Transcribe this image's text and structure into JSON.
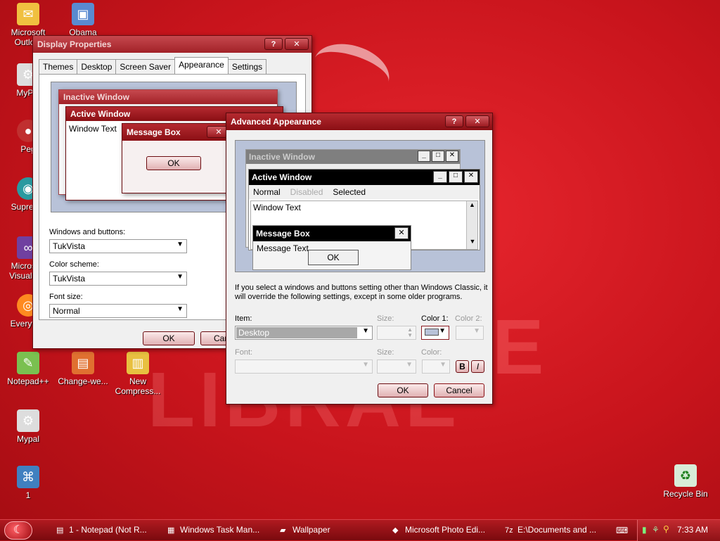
{
  "desktop": {
    "icons": [
      {
        "label": "Microsoft Outlo...",
        "glyph": "✉",
        "color": "#f0c040"
      },
      {
        "label": "Obama",
        "glyph": "▣",
        "color": "#5a8ad0"
      },
      {
        "label": "MyPal",
        "glyph": "⚙",
        "color": "#555555"
      },
      {
        "label": "Peg",
        "glyph": "●",
        "color": "#c03030"
      },
      {
        "label": "Supremo",
        "glyph": "◉",
        "color": "#2a9aa0"
      },
      {
        "label": "Microsoft Visual S...",
        "glyph": "∞",
        "color": "#7040a0"
      },
      {
        "label": "Everyth...",
        "glyph": "◎",
        "color": "#ff8a20"
      },
      {
        "label": "Notepad++",
        "glyph": "✎",
        "color": "#7ac050"
      },
      {
        "label": "Change-we...",
        "glyph": "▤",
        "color": "#e07030"
      },
      {
        "label": "New Compress...",
        "glyph": "▥",
        "color": "#e8c040"
      },
      {
        "label": "Mypal",
        "glyph": "⚙",
        "color": "#555555"
      },
      {
        "label": "1",
        "glyph": "⌘",
        "color": "#4080c0"
      },
      {
        "label": "Recycle Bin",
        "glyph": "♻",
        "color": "#40a040"
      }
    ]
  },
  "display_properties": {
    "title": "Display Properties",
    "help": "?",
    "close": "✕",
    "tabs": [
      "Themes",
      "Desktop",
      "Screen Saver",
      "Appearance",
      "Settings"
    ],
    "preview": {
      "inactive_title": "Inactive Window",
      "active_title": "Active Window",
      "window_text": "Window Text",
      "msgbox_title": "Message Box",
      "msgbox_ok": "OK"
    },
    "windows_buttons_label": "Windows and buttons:",
    "windows_buttons_value": "TukVista",
    "color_scheme_label": "Color scheme:",
    "color_scheme_value": "TukVista",
    "font_size_label": "Font size:",
    "font_size_value": "Normal",
    "ok": "OK",
    "cancel": "Can"
  },
  "advanced": {
    "title": "Advanced Appearance",
    "help": "?",
    "close": "✕",
    "preview": {
      "inactive_title": "Inactive Window",
      "active_title": "Active Window",
      "menu_normal": "Normal",
      "menu_disabled": "Disabled",
      "menu_selected": "Selected",
      "window_text": "Window Text",
      "msgbox_title": "Message Box",
      "msgbox_text": "Message Text",
      "msgbox_ok": "OK"
    },
    "note": "If you select a windows and buttons setting other than Windows Classic, it will override the following settings, except in some older programs.",
    "item_label": "Item:",
    "item_value": "Desktop",
    "size_label": "Size:",
    "color1_label": "Color 1:",
    "color2_label": "Color 2:",
    "font_label": "Font:",
    "font_size_label": "Size:",
    "font_color_label": "Color:",
    "bold": "B",
    "italic": "I",
    "ok": "OK",
    "cancel": "Cancel"
  },
  "taskbar": {
    "tasks": [
      {
        "label": "1 - Notepad (Not R...",
        "glyph": "▤"
      },
      {
        "label": "Windows Task Man...",
        "glyph": "▦"
      },
      {
        "label": "Wallpaper",
        "glyph": "▰"
      },
      {
        "label": "Microsoft Photo Edi...",
        "glyph": "◆"
      },
      {
        "label": "E:\\Documents and ...",
        "glyph": "7z"
      }
    ],
    "clock": "7:33 AM"
  },
  "colors": {
    "accent": "#b52a30",
    "desktop": "#c8141c"
  }
}
